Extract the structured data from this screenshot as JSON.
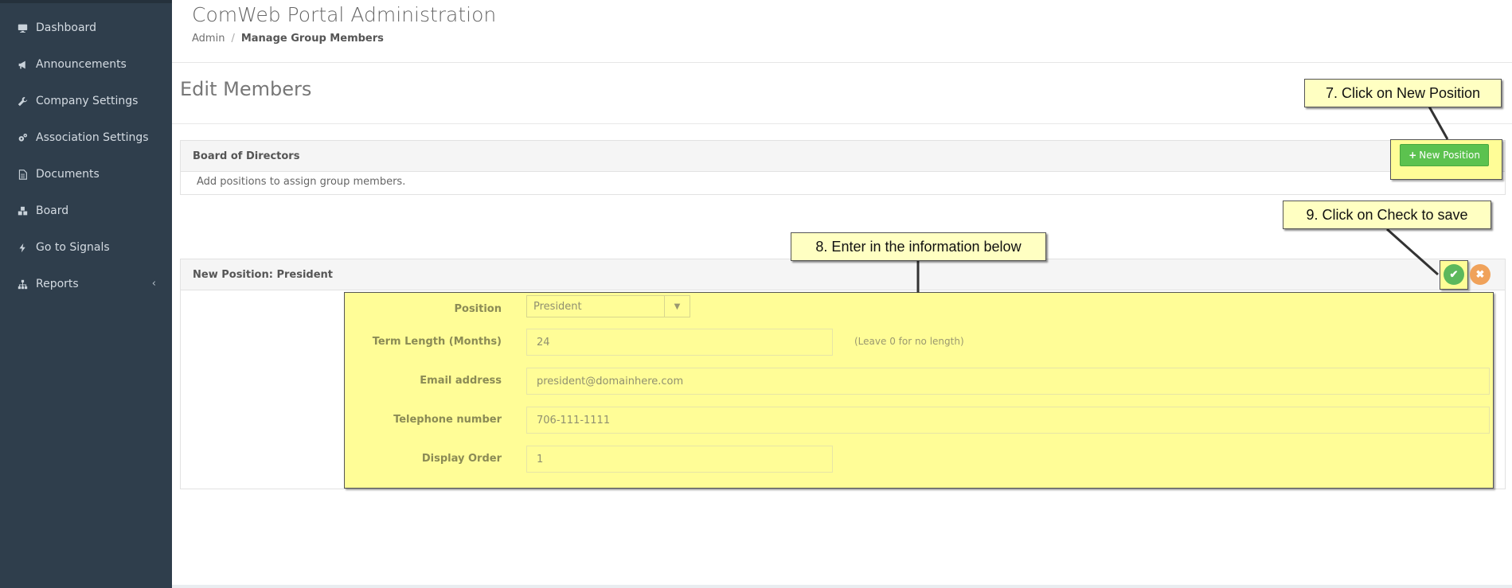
{
  "sidebar": {
    "items": [
      {
        "label": "Dashboard",
        "icon": "monitor-icon"
      },
      {
        "label": "Announcements",
        "icon": "megaphone-icon"
      },
      {
        "label": "Company Settings",
        "icon": "wrench-icon"
      },
      {
        "label": "Association Settings",
        "icon": "gears-icon"
      },
      {
        "label": "Documents",
        "icon": "document-icon"
      },
      {
        "label": "Board",
        "icon": "cubes-icon"
      },
      {
        "label": "Go to Signals",
        "icon": "bolt-icon"
      },
      {
        "label": "Reports",
        "icon": "sitemap-icon",
        "chevron": "‹"
      }
    ]
  },
  "header": {
    "title": "ComWeb Portal Administration",
    "breadcrumb": {
      "root": "Admin",
      "separator": "/",
      "current": "Manage Group Members"
    }
  },
  "page": {
    "heading": "Edit Members"
  },
  "board_panel": {
    "title": "Board of Directors",
    "new_position_label": "New Position",
    "new_position_icon": "+",
    "empty_text": "Add positions to assign group members."
  },
  "position_panel": {
    "title": "New Position: President",
    "save_icon": "✔",
    "cancel_icon": "✖",
    "fields": {
      "position": {
        "label": "Position",
        "value": "President"
      },
      "term_length": {
        "label": "Term Length (Months)",
        "value": "24",
        "hint": "(Leave 0 for no length)"
      },
      "email": {
        "label": "Email address",
        "value": "president@domainhere.com"
      },
      "telephone": {
        "label": "Telephone number",
        "value": "706-111-1111"
      },
      "display_order": {
        "label": "Display Order",
        "value": "1"
      }
    }
  },
  "callouts": {
    "step7": "7. Click on New Position",
    "step8": "8. Enter in the information below",
    "step9": "9. Click on Check to save"
  },
  "colors": {
    "sidebar_bg": "#2f3e4c",
    "highlight_yellow": "#fffd97",
    "callout_bg": "#ffffc2",
    "success_green": "#5cc24f",
    "cancel_orange": "#f0a25a"
  }
}
